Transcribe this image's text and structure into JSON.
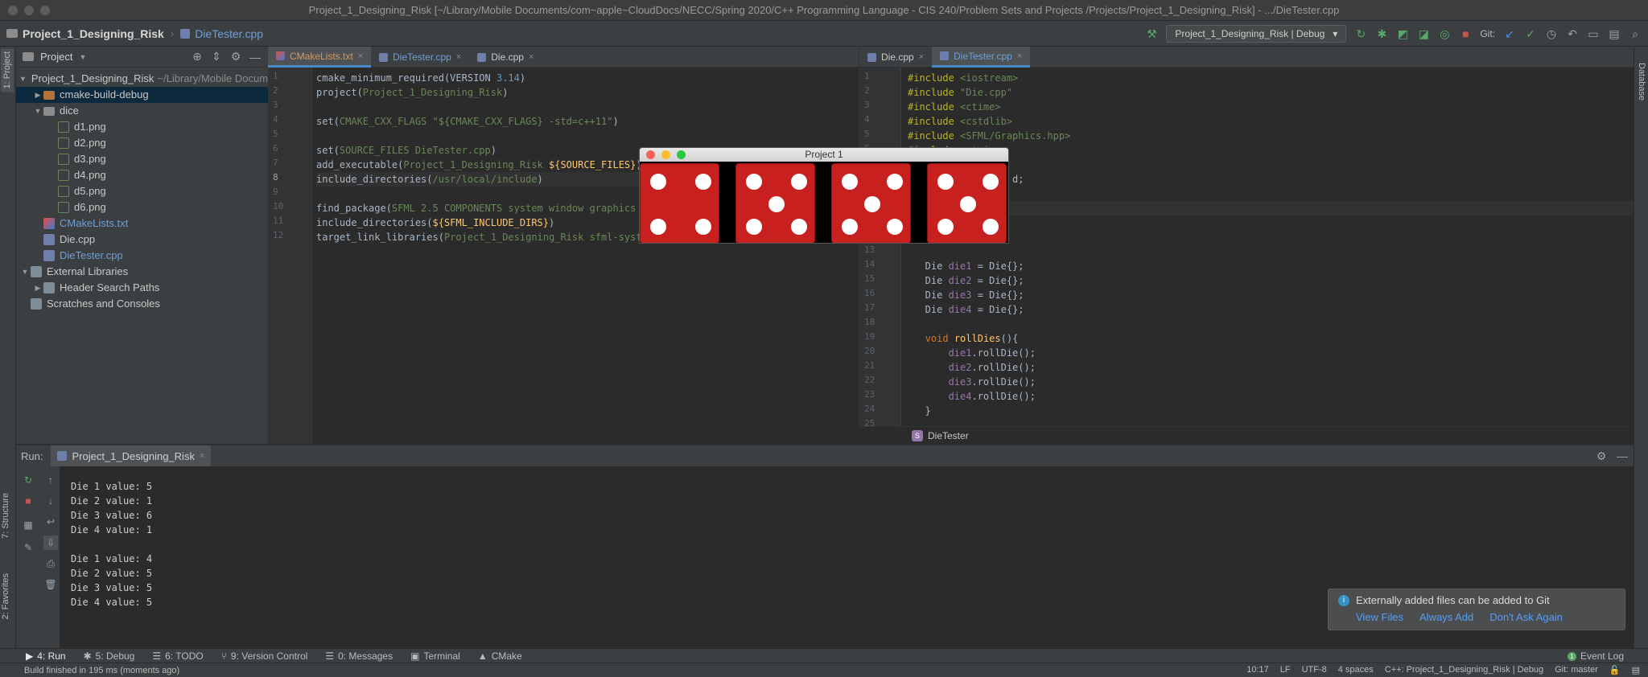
{
  "titlebar": {
    "text": "Project_1_Designing_Risk [~/Library/Mobile Documents/com~apple~CloudDocs/NECC/Spring 2020/C++ Programming Language - CIS 240/Problem Sets and Projects /Projects/Project_1_Designing_Risk] - .../DieTester.cpp"
  },
  "navbar": {
    "project": "Project_1_Designing_Risk",
    "file": "DieTester.cpp",
    "run_config": "Project_1_Designing_Risk | Debug",
    "git_label": "Git:"
  },
  "left_strip": {
    "project_tab": "1: Project",
    "structure_tab": "7: Structure",
    "favorites_tab": "2: Favorites"
  },
  "right_strip": {
    "database_tab": "Database"
  },
  "project_panel": {
    "title": "Project",
    "root": {
      "name": "Project_1_Designing_Risk",
      "path": "~/Library/Mobile Docume"
    },
    "items": [
      {
        "label": "cmake-build-debug"
      },
      {
        "label": "dice"
      },
      {
        "label": "d1.png"
      },
      {
        "label": "d2.png"
      },
      {
        "label": "d3.png"
      },
      {
        "label": "d4.png"
      },
      {
        "label": "d5.png"
      },
      {
        "label": "d6.png"
      },
      {
        "label": "CMakeLists.txt"
      },
      {
        "label": "Die.cpp"
      },
      {
        "label": "DieTester.cpp"
      },
      {
        "label": "External Libraries"
      },
      {
        "label": "Header Search Paths"
      },
      {
        "label": "Scratches and Consoles"
      }
    ]
  },
  "editor_left": {
    "tabs": [
      "CMakeLists.txt",
      "DieTester.cpp",
      "Die.cpp"
    ],
    "line_numbers": [
      "1",
      "2",
      "3",
      "4",
      "5",
      "6",
      "7",
      "8",
      "9",
      "10",
      "11",
      "12"
    ]
  },
  "editor_right": {
    "tabs": [
      "Die.cpp",
      "DieTester.cpp"
    ],
    "line_numbers": [
      "1",
      "2",
      "3",
      "4",
      "5",
      "6",
      "7",
      "8",
      "9",
      "10",
      "11",
      "12",
      "13",
      "14",
      "15",
      "16",
      "17",
      "18",
      "19",
      "20",
      "21",
      "22",
      "23",
      "24",
      "25"
    ],
    "breadcrumb": "DieTester"
  },
  "sfml_window": {
    "title": "Project 1",
    "dice_values": [
      4,
      5,
      5,
      5
    ]
  },
  "run_panel": {
    "label": "Run:",
    "tab": "Project_1_Designing_Risk",
    "output": [
      "Die 1 value: 5",
      "Die 2 value: 1",
      "Die 3 value: 6",
      "Die 4 value: 1",
      "",
      "Die 1 value: 4",
      "Die 2 value: 5",
      "Die 3 value: 5",
      "Die 4 value: 5"
    ]
  },
  "notification": {
    "title": "Externally added files can be added to Git",
    "actions": [
      "View Files",
      "Always Add",
      "Don't Ask Again"
    ]
  },
  "tool_windows": {
    "run": "4: Run",
    "debug": "5: Debug",
    "todo": "6: TODO",
    "vcs": "9: Version Control",
    "messages": "0: Messages",
    "terminal": "Terminal",
    "cmake": "CMake",
    "event_log": "Event Log"
  },
  "status": {
    "message": "Build finished in 195 ms (moments ago)",
    "position": "10:17",
    "line_sep": "LF",
    "encoding": "UTF-8",
    "indent": "4 spaces",
    "context": "C++: Project_1_Designing_Risk | Debug",
    "git": "Git: master"
  },
  "colors": {
    "accent": "#4a88c7",
    "die_red": "#c81f1f",
    "keyword": "#cc7832",
    "string": "#6a8759"
  }
}
